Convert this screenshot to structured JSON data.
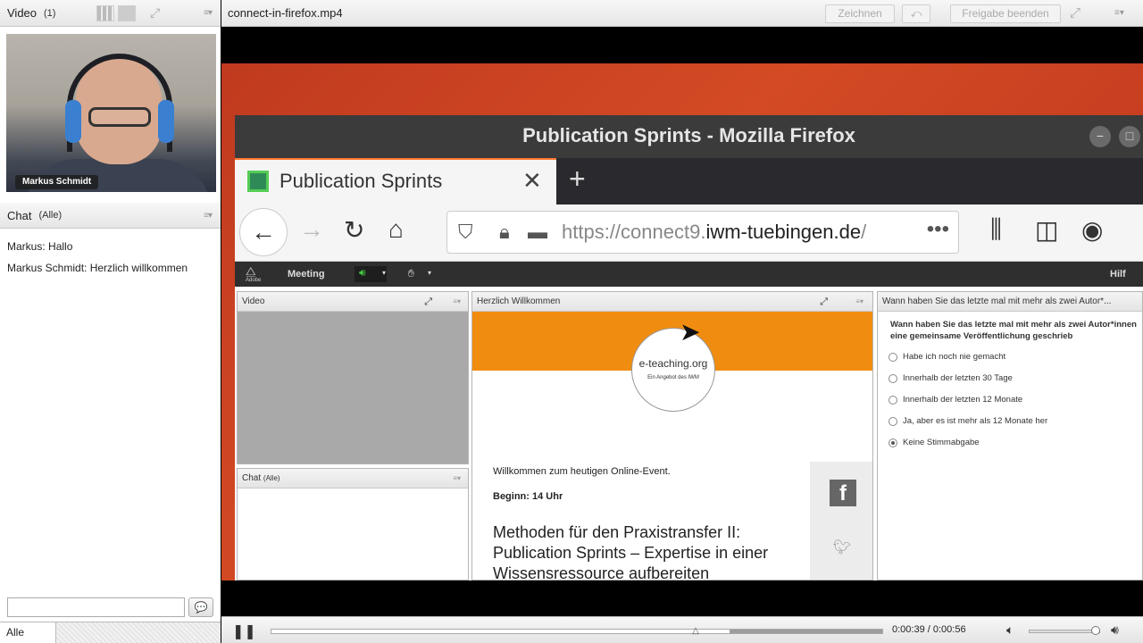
{
  "video_pod": {
    "title": "Video",
    "count": "(1)",
    "participant_name": "Markus Schmidt"
  },
  "chat_pod": {
    "title": "Chat",
    "scope": "(Alle)",
    "messages": [
      {
        "sender": "Markus:",
        "text": "Hallo"
      },
      {
        "sender": "Markus Schmidt:",
        "text": "Herzlich willkommen"
      }
    ],
    "input_value": "",
    "recipient": "Alle"
  },
  "main_header": {
    "file_title": "connect-in-firefox.mp4",
    "zeichnen_label": "Zeichnen",
    "freigabe_label": "Freigabe beenden"
  },
  "firefox": {
    "window_title": "Publication Sprints - Mozilla Firefox",
    "tab_label": "Publication Sprints",
    "url_prefix": "https://connect9.",
    "url_domain": "iwm-tuebingen.de",
    "url_suffix": "/"
  },
  "connect": {
    "menu_meeting": "Meeting",
    "menu_help": "Hilf",
    "adobe_label": "Adobe",
    "video_pane_title": "Video",
    "chat_pane_title": "Chat",
    "chat_pane_scope": "(Alle)",
    "share_pane_title": "Herzlich Willkommen",
    "logo_text": "e-teaching.org",
    "logo_subtext": "Ein Angebot des IWM",
    "welcome_text": "Willkommen zum heutigen Online-Event.",
    "begin_text": "Beginn: 14 Uhr",
    "headline_1": "Methoden für den Praxistransfer II:",
    "headline_2": "Publication Sprints – Expertise in einer",
    "headline_3": "Wissensressource aufbereiten",
    "poll_header": "Wann haben Sie das letzte mal mit mehr als zwei Autor*...",
    "poll_question": "Wann haben Sie das letzte mal mit mehr als zwei Autor*innen eine gemeinsame Veröffentlichung geschrieb",
    "poll_options": [
      "Habe ich noch nie gemacht",
      "Innerhalb der letzten 30 Tage",
      "Innerhalb der letzten 12 Monate",
      "Ja, aber es ist mehr als 12 Monate her",
      "Keine Stimmabgabe"
    ],
    "poll_selected_index": 4
  },
  "player": {
    "time_current": "0:00:39",
    "time_total": "0:00:56",
    "time_display": "0:00:39 / 0:00:56",
    "progress_fraction": 0.696,
    "buffered_fraction": 0.75,
    "volume_fraction": 0.95
  },
  "colors": {
    "accent_orange": "#f08d10",
    "desktop_red": "#c03a1f",
    "firefox_titlebar": "#3b3b3b"
  }
}
